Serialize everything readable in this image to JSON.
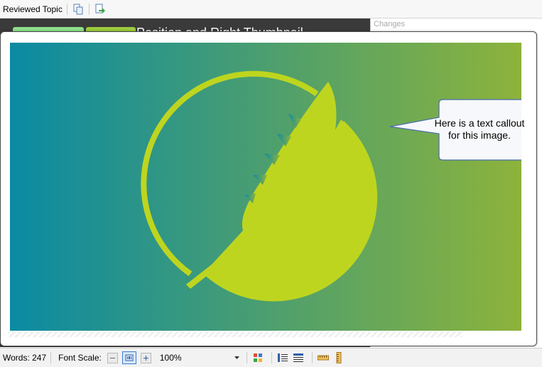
{
  "toolbar": {
    "title": "Reviewed Topic"
  },
  "editor_bg": {
    "heading": "Position and Right    Thumbnail"
  },
  "changes_panel": {
    "title": "Changes"
  },
  "callout": {
    "line1": "Here is a text callout",
    "line2": "for this image."
  },
  "statusbar": {
    "words": "Words: 247",
    "font_scale_label": "Font Scale:",
    "zoom_value": "100%"
  },
  "colors": {
    "gradient_start": "#0a8aa3",
    "gradient_end": "#8db33b",
    "logo": "#bed51f"
  }
}
